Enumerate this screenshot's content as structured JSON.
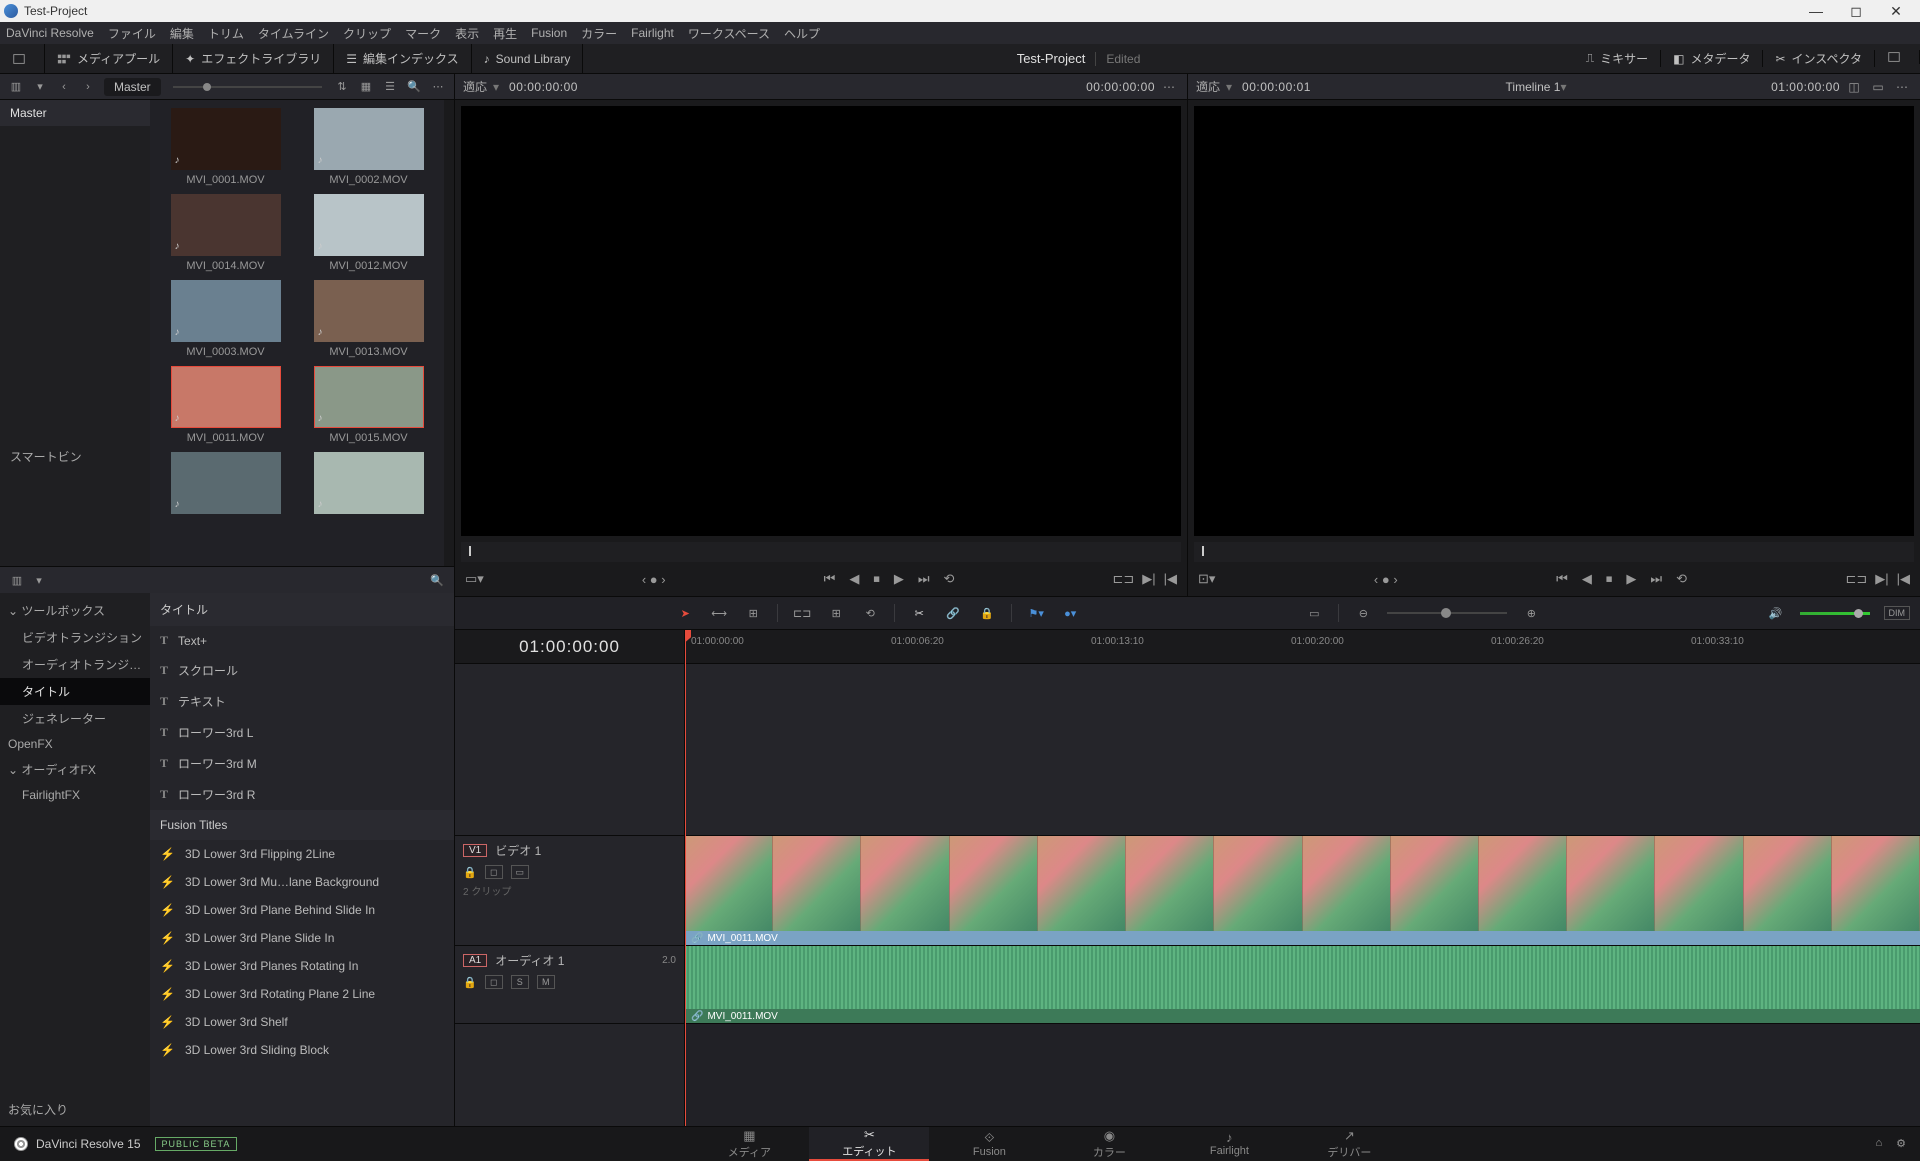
{
  "window": {
    "title": "Test-Project"
  },
  "menubar": [
    "DaVinci Resolve",
    "ファイル",
    "編集",
    "トリム",
    "タイムライン",
    "クリップ",
    "マーク",
    "表示",
    "再生",
    "Fusion",
    "カラー",
    "Fairlight",
    "ワークスペース",
    "ヘルプ"
  ],
  "ws": {
    "media_pool": "メディアプール",
    "effects_lib": "エフェクトライブラリ",
    "edit_index": "編集インデックス",
    "sound_lib": "Sound Library",
    "project": "Test-Project",
    "status": "Edited",
    "mixer": "ミキサー",
    "metadata": "メタデータ",
    "inspector": "インスペクタ"
  },
  "mp": {
    "master": "Master",
    "tree_master": "Master",
    "smart_bin": "スマートビン",
    "clips": [
      {
        "name": "MVI_0001.MOV",
        "sel": false,
        "bg": "#2a1a14"
      },
      {
        "name": "MVI_0002.MOV",
        "sel": false,
        "bg": "#9aa8b0"
      },
      {
        "name": "MVI_0014.MOV",
        "sel": false,
        "bg": "#4a3530"
      },
      {
        "name": "MVI_0012.MOV",
        "sel": false,
        "bg": "#b8c4c8"
      },
      {
        "name": "MVI_0003.MOV",
        "sel": false,
        "bg": "#6a8090"
      },
      {
        "name": "MVI_0013.MOV",
        "sel": false,
        "bg": "#7a6050"
      },
      {
        "name": "MVI_0011.MOV",
        "sel": true,
        "bg": "#c87868"
      },
      {
        "name": "MVI_0015.MOV",
        "sel": true,
        "bg": "#8a9888"
      },
      {
        "name": "",
        "sel": false,
        "bg": "#5a6a70"
      },
      {
        "name": "",
        "sel": false,
        "bg": "#a8b8b0"
      }
    ]
  },
  "fx": {
    "cats": [
      {
        "label": "ツールボックス",
        "sub": false,
        "active": false,
        "exp": true
      },
      {
        "label": "ビデオトランジション",
        "sub": true,
        "active": false
      },
      {
        "label": "オーディオトランジ…",
        "sub": true,
        "active": false
      },
      {
        "label": "タイトル",
        "sub": true,
        "active": true
      },
      {
        "label": "ジェネレーター",
        "sub": true,
        "active": false
      },
      {
        "label": "OpenFX",
        "sub": false,
        "active": false
      },
      {
        "label": "オーディオFX",
        "sub": false,
        "active": false,
        "exp": true
      },
      {
        "label": "FairlightFX",
        "sub": true,
        "active": false
      }
    ],
    "favorites": "お気に入り",
    "titles_hdr": "タイトル",
    "titles": [
      "Text+",
      "スクロール",
      "テキスト",
      "ローワー3rd L",
      "ローワー3rd M",
      "ローワー3rd R"
    ],
    "fusion_hdr": "Fusion Titles",
    "fusion": [
      "3D Lower 3rd Flipping 2Line",
      "3D Lower 3rd Mu…lane Background",
      "3D Lower 3rd Plane Behind Slide In",
      "3D Lower 3rd Plane Slide In",
      "3D Lower 3rd Planes Rotating In",
      "3D Lower 3rd Rotating Plane 2 Line",
      "3D Lower 3rd Shelf",
      "3D Lower 3rd Sliding Block"
    ]
  },
  "viewer_src": {
    "fit": "適応",
    "tc_left": "00:00:00:00",
    "tc_right": "00:00:00:00"
  },
  "viewer_tl": {
    "fit": "適応",
    "tc_left": "00:00:00:01",
    "name": "Timeline 1",
    "tc_right": "01:00:00:00"
  },
  "timeline": {
    "tc": "01:00:00:00",
    "ticks": [
      "01:00:00:00",
      "01:00:06:20",
      "01:00:13:10",
      "01:00:20:00",
      "01:00:26:20",
      "01:00:33:10"
    ],
    "v1": {
      "tag": "V1",
      "name": "ビデオ 1",
      "meta": "2 クリップ",
      "clip": "MVI_0011.MOV"
    },
    "a1": {
      "tag": "A1",
      "name": "オーディオ 1",
      "ch": "2.0",
      "clip": "MVI_0011.MOV",
      "s": "S",
      "m": "M"
    }
  },
  "toolbar": {
    "dim": "DIM"
  },
  "pages": {
    "brand": "DaVinci Resolve 15",
    "beta": "PUBLIC BETA",
    "items": [
      "メディア",
      "エディット",
      "Fusion",
      "カラー",
      "Fairlight",
      "デリバー"
    ]
  }
}
